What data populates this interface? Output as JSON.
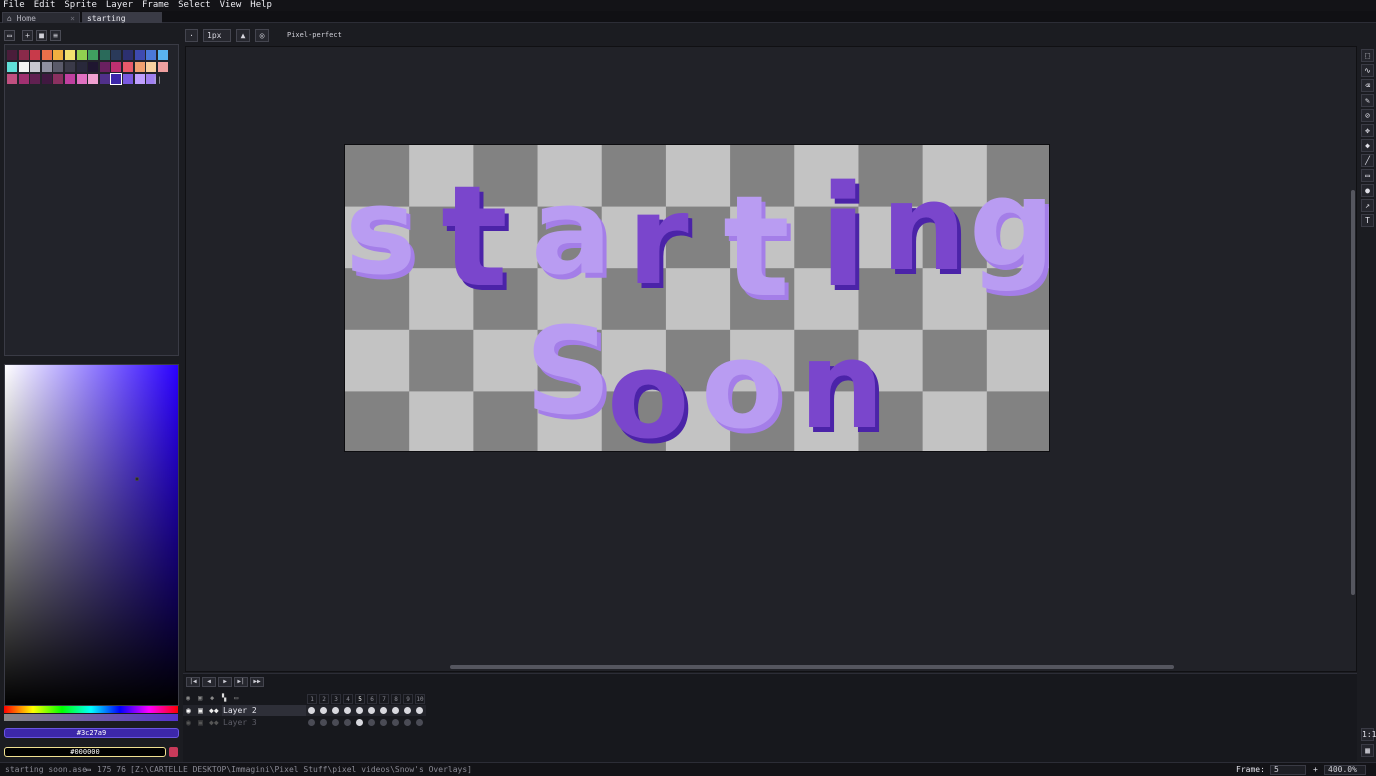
{
  "menubar": {
    "items": [
      "File",
      "Edit",
      "Sprite",
      "Layer",
      "Frame",
      "Select",
      "View",
      "Help"
    ]
  },
  "tabs": [
    {
      "label": "Home",
      "close": "×"
    },
    {
      "label": "starting soon.a",
      "modified_dot": "●"
    }
  ],
  "toolbar": {
    "brush_size": "1px",
    "pixel_perfect_label": "Pixel-perfect"
  },
  "palette": {
    "colors": [
      "#4a1d3a",
      "#8a2a4a",
      "#c83a4a",
      "#e8704a",
      "#f0b040",
      "#f0e070",
      "#90d050",
      "#40a060",
      "#2a6a5a",
      "#2a3a5a",
      "#2c3070",
      "#3e4ab0",
      "#4b78d8",
      "#5ab4f0",
      "#60e0d8",
      "#f4f4f4",
      "#c8c8d0",
      "#9090a0",
      "#5a5a6a",
      "#3a3a48",
      "#28283a",
      "#1f1630",
      "#6a2060",
      "#c03070",
      "#e85a6a",
      "#f0a070",
      "#f8d0a0",
      "#f0a0a0",
      "#c05080",
      "#a03070",
      "#602050",
      "#401840",
      "#8a3060",
      "#c040a0",
      "#e070c0",
      "#f0a0d0",
      "#50308a",
      "#3c27a9",
      "#7a5ae0",
      "#c0a0ff",
      "#a080f0"
    ],
    "selected_index": 37
  },
  "colors": {
    "foreground": "#3c27a9",
    "background": "#000000",
    "accent": "#3c27a9",
    "letter_light": "#b99cf2",
    "letter_light_shade": "#a47ee8",
    "letter_dark": "#7a46cc",
    "letter_dark_shade": "#4b23a8",
    "checker_light": "#c3c3c3",
    "checker_dark": "#828282"
  },
  "timeline": {
    "frames": [
      "1",
      "2",
      "3",
      "4",
      "5",
      "6",
      "7",
      "8",
      "9",
      "10"
    ],
    "current_frame": 5,
    "layers": [
      {
        "name": "Layer 2",
        "visible": true
      },
      {
        "name": "Layer 3",
        "visible": false
      }
    ]
  },
  "status": {
    "filename": "starting soon.ase",
    "coords": "175 76",
    "path": "[Z:\\CARTELLE DESKTOP\\Immagini\\Pixel Stuff\\pixel videos\\Snow's Overlays]",
    "frame_label": "Frame:",
    "frame_value": "5",
    "plus": "+",
    "zoom": "400.0%"
  },
  "icons": {
    "tools": [
      "marquee-icon",
      "lasso-icon",
      "eraser-icon",
      "pencil-icon",
      "eyedropper-icon",
      "move-icon",
      "paint-bucket-icon",
      "line-icon",
      "rectangle-icon",
      "blur-icon",
      "smudge-icon",
      "text-icon"
    ]
  }
}
